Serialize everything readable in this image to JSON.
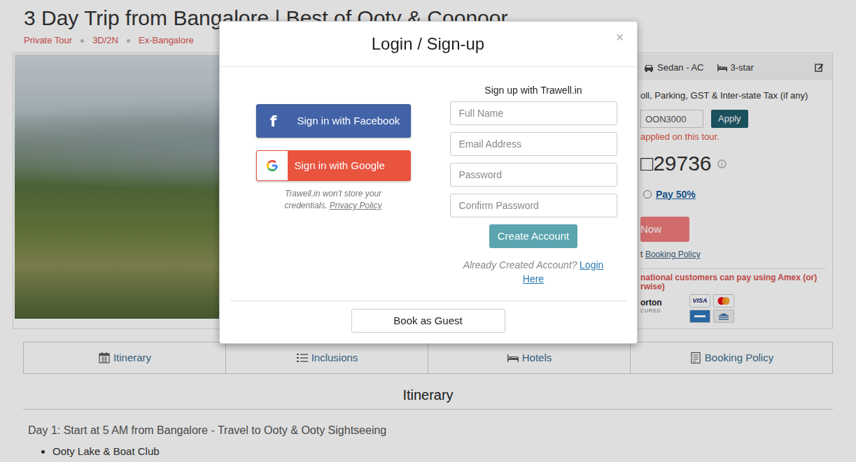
{
  "tour": {
    "title": "3 Day Trip from Bangalore | Best of Ooty & Coonoor",
    "tags": [
      "Private Tour",
      "3D/2N",
      "Ex-Bangalore"
    ],
    "options": [
      {
        "label": "Sedan - AC",
        "kind": "vehicle"
      },
      {
        "label": "3-star",
        "kind": "hotel"
      }
    ],
    "inclusions_note": "oll, Parking, GST & Inter-state Tax (if any)",
    "coupon": {
      "value": "OON3000",
      "button": "Apply",
      "message": "applied on this tour."
    },
    "price": {
      "currency": "□",
      "amount": "29736"
    },
    "payment_options": [
      {
        "label": "Pay 50%",
        "selected": false
      }
    ],
    "book_button": "Now",
    "policy_note": {
      "prefix": "t",
      "link": "Booking Policy"
    },
    "intl_note": [
      "national customers can pay using Amex (or)",
      "rwise)"
    ],
    "security_badge": {
      "name": "orton",
      "sub": "CURED"
    },
    "card_logos": [
      {
        "kind": "visa",
        "label": "VISA"
      },
      {
        "kind": "mastercard"
      },
      {
        "kind": "amex"
      },
      {
        "kind": "netbanking"
      }
    ]
  },
  "tabs": [
    {
      "label": "Itinerary",
      "selected": false
    },
    {
      "label": "Inclusions",
      "selected": false
    },
    {
      "label": "Hotels",
      "selected": false
    },
    {
      "label": "Booking Policy",
      "selected": false
    }
  ],
  "itinerary": {
    "heading": "Itinerary",
    "days": [
      {
        "title": "Day 1: Start at 5 AM from Bangalore - Travel to Ooty & Ooty Sightseeing",
        "items": [
          "Ooty Lake & Boat Club"
        ]
      }
    ]
  },
  "modal": {
    "title": "Login / Sign-up",
    "close": "×",
    "social": [
      {
        "kind": "facebook",
        "icon": "f",
        "label": "Sign in with Facebook"
      },
      {
        "kind": "google",
        "label": "Sign in with Google"
      }
    ],
    "disclaimer": "Trawell.in won't store your credentials.",
    "privacy_link": "Privacy Policy",
    "signup_title": "Sign up with Trawell.in",
    "fields": [
      {
        "kind": "text",
        "placeholder": "Full Name"
      },
      {
        "kind": "email",
        "placeholder": "Email Address"
      },
      {
        "kind": "password",
        "placeholder": "Password"
      },
      {
        "kind": "password",
        "placeholder": "Confirm Password"
      }
    ],
    "create_button": "Create Account",
    "login_prompt": "Already Created Account?",
    "login_link": "Login Here",
    "guest_button": "Book as Guest"
  }
}
